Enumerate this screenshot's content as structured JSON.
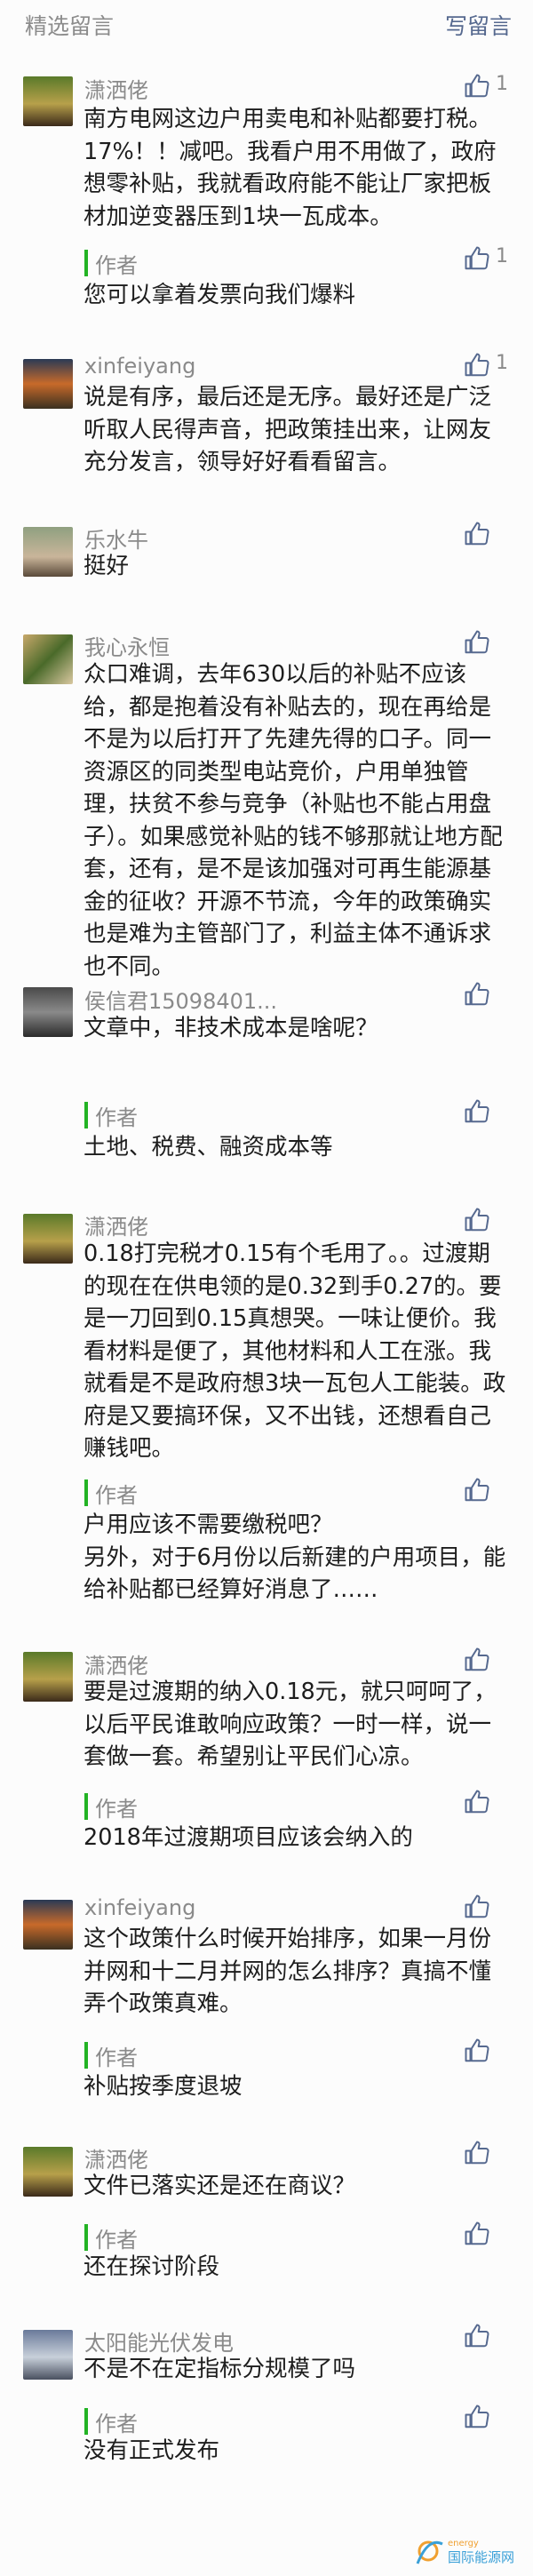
{
  "header": {
    "title": "精选留言",
    "write_label": "写留言"
  },
  "author_label": "作者",
  "comments": [
    {
      "name": "潇洒佬",
      "likes": "1",
      "text": "南方电网这边户用卖电和补贴都要打税。17%！！减吧。我看户用不用做了，政府想零补贴，我就看政府能不能让厂家把板材加逆变器压到1块一瓦成本。",
      "reply": "您可以拿着发票向我们爆料",
      "reply_likes": "1"
    },
    {
      "name": "xinfeiyang",
      "likes": "1",
      "text": "说是有序，最后还是无序。最好还是广泛听取人民得声音，把政策挂出来，让网友充分发言，领导好好看看留言。"
    },
    {
      "name": "乐水牛",
      "text": "挺好"
    },
    {
      "name": "我心永恒",
      "text": "众口难调，去年630以后的补贴不应该给，都是抱着没有补贴去的，现在再给是不是为以后打开了先建先得的口子。同一资源区的同类型电站竞价，户用单独管理，扶贫不参与竞争（补贴也不能占用盘子）。如果感觉补贴的钱不够那就让地方配套，还有，是不是该加强对可再生能源基金的征收？开源不节流，今年的政策确实也是难为主管部门了，利益主体不通诉求也不同。"
    },
    {
      "name": "侯信君15098401...",
      "text": "文章中，非技术成本是啥呢？",
      "reply": "土地、税费、融资成本等"
    },
    {
      "name": "潇洒佬",
      "text": "0.18打完税才0.15有个毛用了。。过渡期的现在在供电领的是0.32到手0.27的。要是一刀回到0.15真想哭。一味让便价。我看材料是便了，其他材料和人工在涨。我就看是不是政府想3块一瓦包人工能装。政府是又要搞环保，又不出钱，还想看自己赚钱吧。",
      "reply": "户用应该不需要缴税吧？\n另外，对于6月份以后新建的户用项目，能给补贴都已经算好消息了……"
    },
    {
      "name": "潇洒佬",
      "text": "要是过渡期的纳入0.18元，就只呵呵了，以后平民谁敢响应政策？一时一样，说一套做一套。希望别让平民们心凉。",
      "reply": "2018年过渡期项目应该会纳入的"
    },
    {
      "name": "xinfeiyang",
      "text": "这个政策什么时候开始排序，如果一月份并网和十二月并网的怎么排序？真搞不懂弄个政策真难。",
      "reply": "补贴按季度退坡"
    },
    {
      "name": "潇洒佬",
      "text": "文件已落实还是还在商议？",
      "reply": "还在探讨阶段"
    },
    {
      "name": "太阳能光伏发电",
      "text": "不是不在定指标分规模了吗",
      "reply": "没有正式发布"
    }
  ],
  "watermark": {
    "text": "国际能源网",
    "brand": "energy"
  },
  "colors": {
    "accent": "#56698f",
    "author_bar": "#23b324"
  }
}
